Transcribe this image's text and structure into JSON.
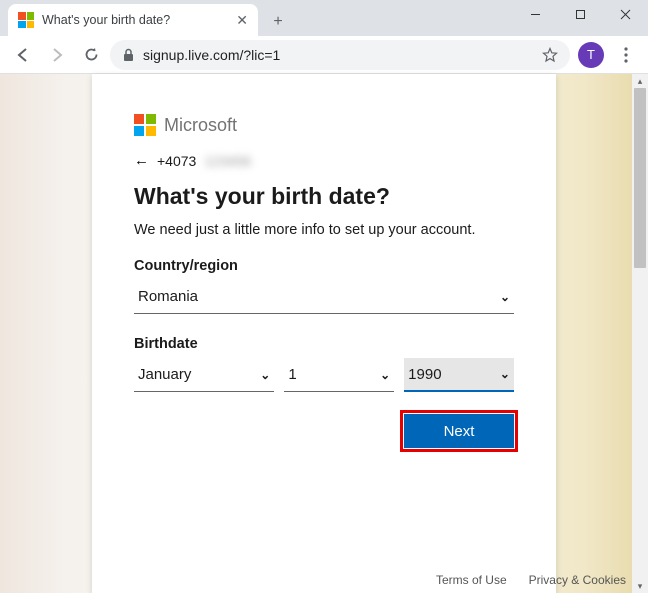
{
  "window": {
    "minimize": "—",
    "maximize": "☐",
    "close": "✕"
  },
  "tab": {
    "title": "What's your birth date?"
  },
  "toolbar": {
    "url": "signup.live.com/?lic=1",
    "avatar_letter": "T"
  },
  "brand": {
    "name": "Microsoft"
  },
  "identity": {
    "phone_prefix": "+4073",
    "phone_rest": "123456"
  },
  "heading": "What's your birth date?",
  "subtitle": "We need just a little more info to set up your account.",
  "labels": {
    "country": "Country/region",
    "birthdate": "Birthdate"
  },
  "fields": {
    "country": "Romania",
    "month": "January",
    "day": "1",
    "year": "1990"
  },
  "buttons": {
    "next": "Next"
  },
  "footer": {
    "terms": "Terms of Use",
    "privacy": "Privacy & Cookies"
  }
}
